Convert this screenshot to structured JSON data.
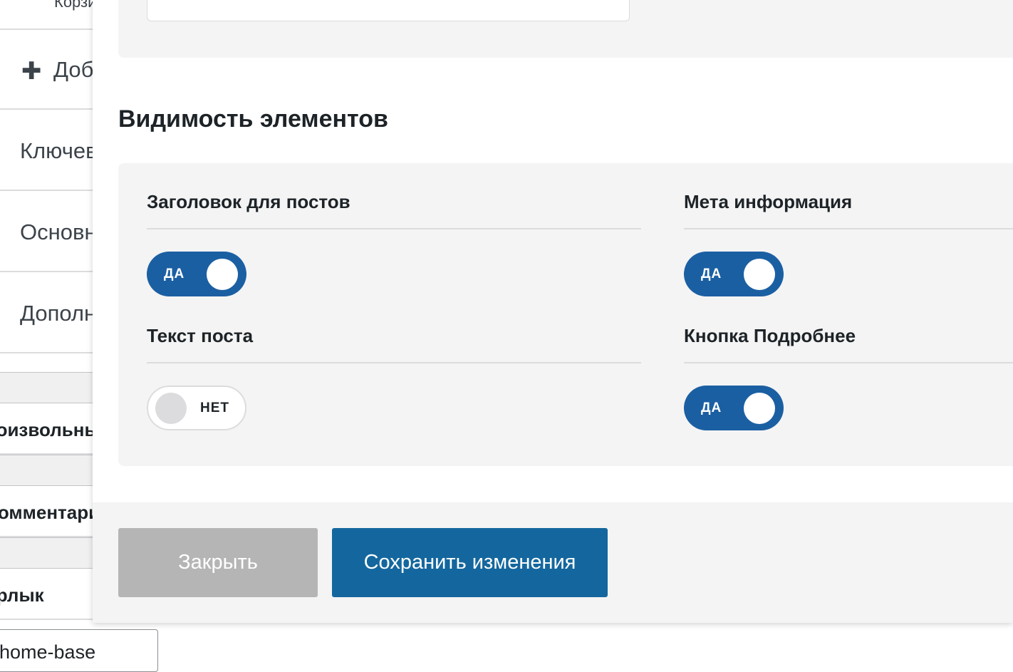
{
  "background_sidebar": {
    "items": [
      {
        "label": "Корзина"
      },
      {
        "label": "Добавить новую"
      },
      {
        "label": "Ключевые"
      },
      {
        "label": "Основные"
      },
      {
        "label": "Дополнительные"
      }
    ],
    "bold_rows": [
      {
        "label": "Произвольные поля"
      },
      {
        "label": "Комментарии"
      },
      {
        "label": "Ярлык"
      }
    ],
    "slug_value": "home-base"
  },
  "modal": {
    "section_title": "Видимость элементов",
    "options": [
      {
        "label": "Заголовок для постов",
        "enabled": true,
        "state_text": "ДА"
      },
      {
        "label": "Мета информация",
        "enabled": true,
        "state_text": "ДА"
      },
      {
        "label": "Текст поста",
        "enabled": false,
        "state_text": "НЕТ"
      },
      {
        "label": "Кнопка Подробнее",
        "enabled": true,
        "state_text": "ДА"
      }
    ],
    "footer": {
      "close_label": "Закрыть",
      "save_label": "Сохранить изменения"
    }
  },
  "colors": {
    "toggle_on": "#1b5fa3",
    "save_button": "#14679e",
    "close_button": "#b5b5b5",
    "panel_bg": "#f4f4f4"
  }
}
